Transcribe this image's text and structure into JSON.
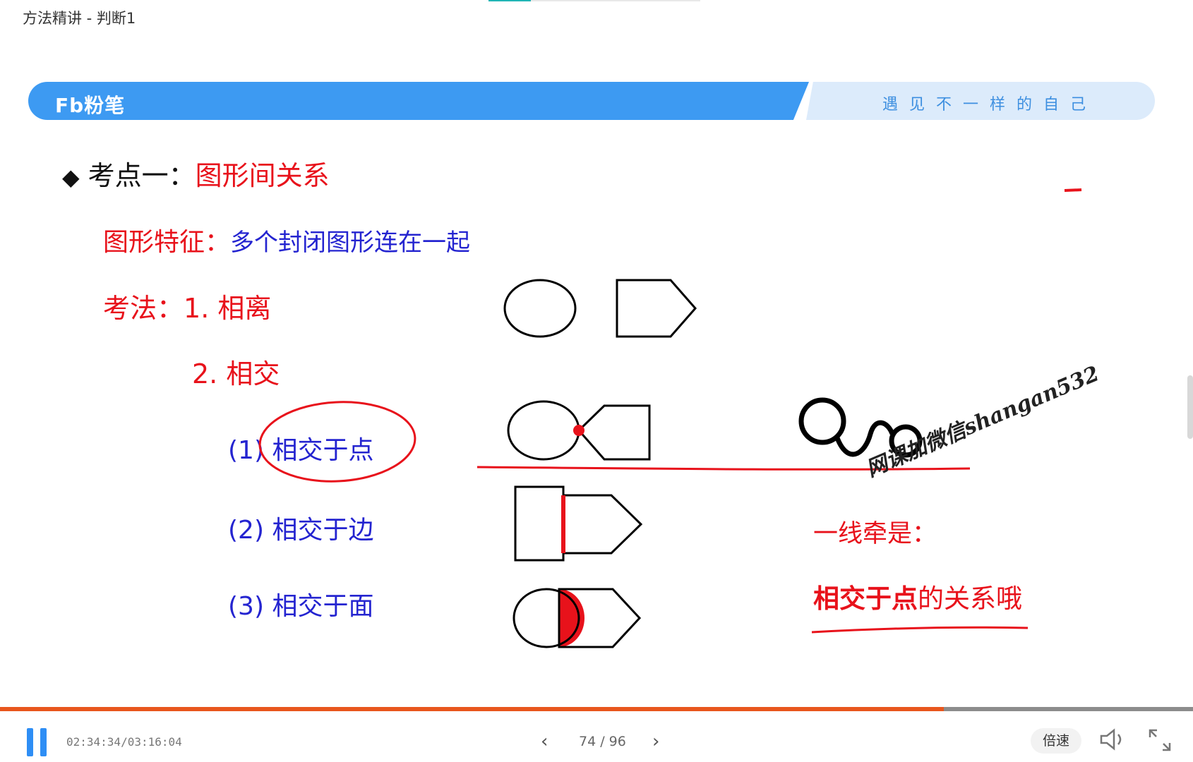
{
  "window": {
    "title": "方法精讲 - 判断1"
  },
  "banner": {
    "logo": "Fb粉笔",
    "slogan": "遇见不一样的自己"
  },
  "slide": {
    "heading": {
      "bullet": "◆",
      "prefix": "考点一：",
      "topic": "图形间关系"
    },
    "feature": {
      "label": "图形特征：",
      "text": "多个封闭图形连在一起"
    },
    "method": {
      "label": "考法：",
      "item1": "1. 相离",
      "item2": "2. 相交"
    },
    "subitems": [
      {
        "num": "(1)",
        "text": "相交于点"
      },
      {
        "num": "(2)",
        "text": "相交于边"
      },
      {
        "num": "(3)",
        "text": "相交于面"
      }
    ],
    "note": {
      "line1": "一线牵是：",
      "bold": "相交于点",
      "rest": "的关系哦"
    },
    "watermark": "网课加微信shangan532"
  },
  "player": {
    "timecode": "02:34:34/03:16:04",
    "page": "74 / 96",
    "prev_icon": "chevron-left",
    "next_icon": "chevron-right",
    "speed_label": "倍速",
    "progress": 0.791
  },
  "colors": {
    "red": "#e8121b",
    "blue_text": "#2424d0",
    "banner_blue": "#3d9af2",
    "progress_played": "#e8561d",
    "pause_blue": "#2e8ef5"
  }
}
